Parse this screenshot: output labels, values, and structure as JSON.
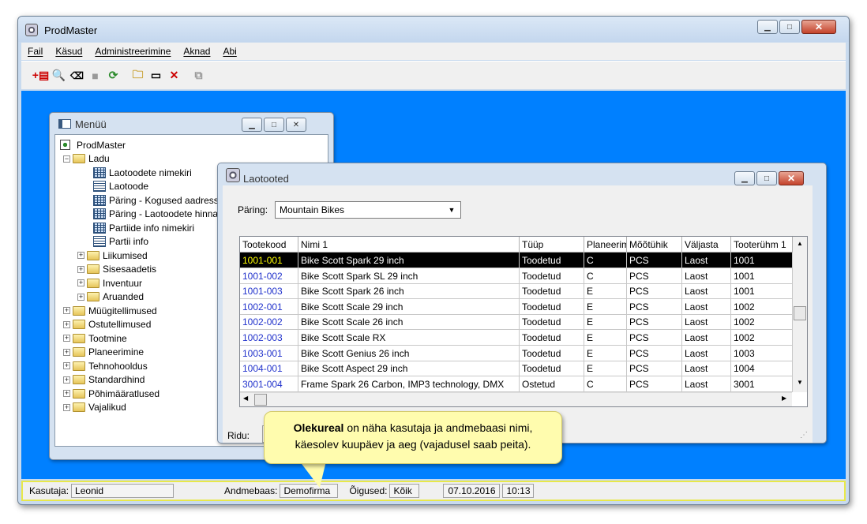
{
  "app": {
    "title": "ProdMaster"
  },
  "menubar": {
    "items": [
      "Fail",
      "Käsud",
      "Administreerimine",
      "Aknad",
      "Abi"
    ]
  },
  "toolbar": {
    "icons": [
      "add-record-icon",
      "binoculars-icon",
      "eraser-icon",
      "stop-icon",
      "refresh-icon",
      "open-folder-icon",
      "new-window-icon",
      "delete-icon",
      "copy-icon"
    ]
  },
  "menu_window": {
    "title": "Menüü",
    "tree": [
      {
        "label": "ProdMaster",
        "kind": "root"
      },
      {
        "label": "Ladu",
        "kind": "folder-open"
      },
      {
        "label": "Laotoodete nimekiri",
        "kind": "grid"
      },
      {
        "label": "Laotoode",
        "kind": "form"
      },
      {
        "label": "Päring - Kogused aadressi",
        "kind": "grid"
      },
      {
        "label": "Päring - Laotoodete hinna",
        "kind": "grid"
      },
      {
        "label": "Partiide info nimekiri",
        "kind": "grid"
      },
      {
        "label": "Partii info",
        "kind": "form"
      },
      {
        "label": "Liikumised",
        "kind": "folder"
      },
      {
        "label": "Sisesaadetis",
        "kind": "folder"
      },
      {
        "label": "Inventuur",
        "kind": "folder"
      },
      {
        "label": "Aruanded",
        "kind": "folder"
      },
      {
        "label": "Müügitellimused",
        "kind": "folder"
      },
      {
        "label": "Ostutellimused",
        "kind": "folder"
      },
      {
        "label": "Tootmine",
        "kind": "folder"
      },
      {
        "label": "Planeerimine",
        "kind": "folder"
      },
      {
        "label": "Tehnohooldus",
        "kind": "folder"
      },
      {
        "label": "Standardhind",
        "kind": "folder"
      },
      {
        "label": "Põhimääratlused",
        "kind": "folder"
      },
      {
        "label": "Vajalikud",
        "kind": "folder"
      }
    ]
  },
  "products_window": {
    "title": "Laotooted",
    "query_label": "Päring:",
    "query_value": "Mountain Bikes",
    "columns": [
      "Tootekood",
      "Nimi 1",
      "Tüüp",
      "Planeerim",
      "Mõõtühik",
      "Väljasta",
      "Tooterühm 1"
    ],
    "rows": [
      [
        "1001-001",
        "Bike Scott Spark 29 inch",
        "Toodetud",
        "C",
        "PCS",
        "Laost",
        "1001"
      ],
      [
        "1001-002",
        "Bike Scott Spark SL 29 inch",
        "Toodetud",
        "C",
        "PCS",
        "Laost",
        "1001"
      ],
      [
        "1001-003",
        "Bike Scott Spark 26 inch",
        "Toodetud",
        "E",
        "PCS",
        "Laost",
        "1001"
      ],
      [
        "1002-001",
        "Bike Scott Scale 29 inch",
        "Toodetud",
        "E",
        "PCS",
        "Laost",
        "1002"
      ],
      [
        "1002-002",
        "Bike Scott Scale 26 inch",
        "Toodetud",
        "E",
        "PCS",
        "Laost",
        "1002"
      ],
      [
        "1002-003",
        "Bike Scott Scale RX",
        "Toodetud",
        "E",
        "PCS",
        "Laost",
        "1002"
      ],
      [
        "1003-001",
        "Bike Scott Genius 26 inch",
        "Toodetud",
        "E",
        "PCS",
        "Laost",
        "1003"
      ],
      [
        "1004-001",
        "Bike Scott Aspect 29 inch",
        "Toodetud",
        "E",
        "PCS",
        "Laost",
        "1004"
      ],
      [
        "3001-004",
        "Frame Spark 26 Carbon, IMP3 technology, DMX",
        "Ostetud",
        "C",
        "PCS",
        "Laost",
        "3001"
      ]
    ],
    "rows_label": "Ridu:"
  },
  "callout": {
    "bold": "Olekureal",
    "text1": " on näha kasutaja ja andmebaasi nimi,",
    "text2": "käesolev kuupäev ja aeg (vajadusel saab peita)."
  },
  "statusbar": {
    "user_label": "Kasutaja:",
    "user_value": "Leonid",
    "db_label": "Andmebaas:",
    "db_value": "Demofirma",
    "rights_label": "Õigused:",
    "rights_value": "Kõik",
    "date": "07.10.2016",
    "time": "10:13"
  },
  "colors": {
    "desktop": "#0080ff",
    "selected_code": "#ffff00",
    "code_link": "#2233cc",
    "status_highlight": "#e8e84a",
    "callout": "#fffcae"
  }
}
